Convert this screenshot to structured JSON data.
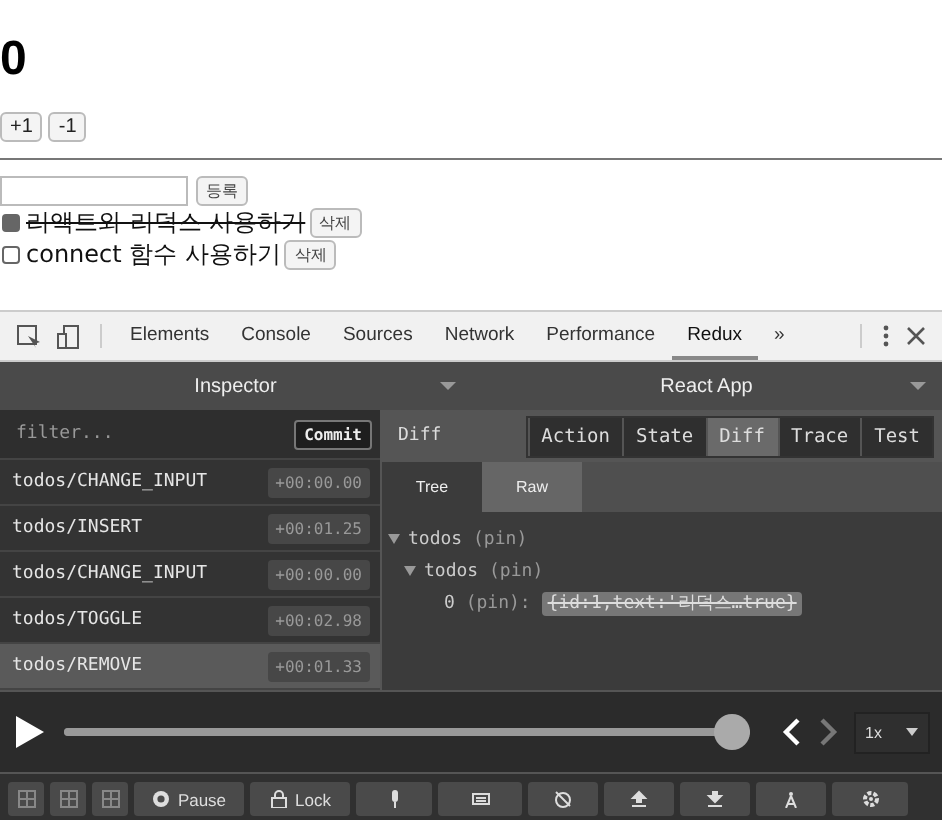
{
  "counter": {
    "number": "0",
    "buttons": [
      "+1",
      "-1"
    ]
  },
  "todos": {
    "add_button": "등록",
    "items": [
      {
        "text": "리액트와 리덕스 사용하기",
        "done": true,
        "delete_label": "삭제"
      },
      {
        "text": "connect 함수 사용하기",
        "done": false,
        "delete_label": "삭제"
      }
    ]
  },
  "devtools": {
    "tabs": [
      {
        "label": "Elements",
        "selected": false
      },
      {
        "label": "Console",
        "selected": false
      },
      {
        "label": "Sources",
        "selected": false
      },
      {
        "label": "Network",
        "selected": false
      },
      {
        "label": "Performance",
        "selected": false
      },
      {
        "label": "Redux",
        "selected": true
      }
    ],
    "more": "»"
  },
  "redux": {
    "inspector_title": "Inspector",
    "app_title": "React App",
    "filter": {
      "placeholder": "filter..."
    },
    "commit_button": "Commit",
    "actions": [
      {
        "type": "todos/CHANGE_INPUT",
        "time": "+00:00.00",
        "selected": false
      },
      {
        "type": "todos/INSERT",
        "time": "+00:01.25",
        "selected": false
      },
      {
        "type": "todos/CHANGE_INPUT",
        "time": "+00:00.00",
        "selected": false
      },
      {
        "type": "todos/TOGGLE",
        "time": "+00:02.98",
        "selected": false
      },
      {
        "type": "todos/REMOVE",
        "time": "+00:01.33",
        "selected": true
      }
    ],
    "panel_title": "Diff",
    "modes": [
      {
        "label": "Action",
        "selected": false
      },
      {
        "label": "State",
        "selected": false
      },
      {
        "label": "Diff",
        "selected": true
      },
      {
        "label": "Trace",
        "selected": false
      },
      {
        "label": "Test",
        "selected": false
      }
    ],
    "view_tabs": [
      {
        "label": "Tree",
        "selected": true
      },
      {
        "label": "Raw",
        "selected": false
      }
    ],
    "diff_tree": [
      {
        "key": "todos",
        "note": "(pin)",
        "children": [
          {
            "key": "todos",
            "note": "(pin)",
            "children": [
              {
                "key": "0",
                "note": "(pin):",
                "value": "{id:1,text:'리덕스…true}",
                "removed": true
              }
            ]
          }
        ]
      }
    ],
    "slider": {
      "level": 1.0
    },
    "speed": "1x",
    "toolbar": {
      "pause": "Pause",
      "lock": "Lock"
    }
  }
}
